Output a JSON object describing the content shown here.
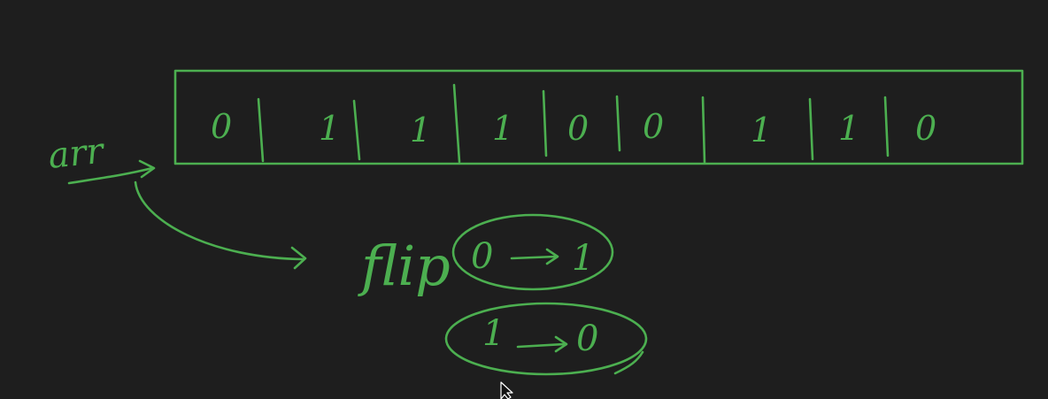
{
  "canvas": {
    "background": "#1e1e1e",
    "ink_color": "#4caf50"
  },
  "array": {
    "label": "arr",
    "values": [
      "0",
      "1",
      "1",
      "1",
      "0",
      "0",
      "1",
      "1",
      "0"
    ]
  },
  "flip": {
    "label": "flip",
    "rule_one": {
      "from": "0",
      "to": "1"
    },
    "rule_two": {
      "from": "1",
      "to": "0"
    }
  },
  "icons": {
    "cursor": "mouse-cursor-icon"
  }
}
